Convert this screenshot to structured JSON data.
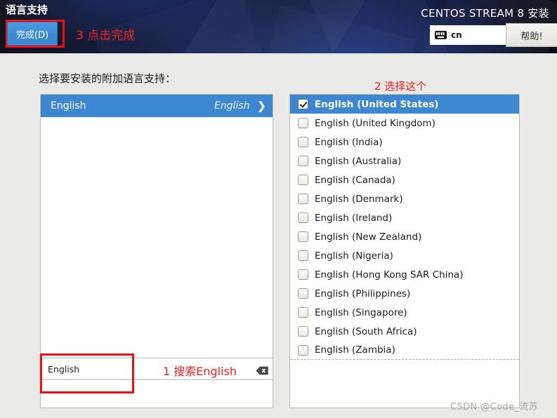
{
  "header": {
    "page_heading": "语言支持",
    "product_title": "CENTOS STREAM 8 安装",
    "done_label": "完成(D)",
    "keyboard_layout": "cn",
    "keyboard_icon": "keyboard-icon",
    "help_label": "帮助!"
  },
  "annotations": {
    "step1": "1 搜索English",
    "step2": "2 选择这个",
    "step3": "3 点击完成"
  },
  "main": {
    "prompt": "选择要安装的附加语言支持：",
    "language_list": [
      {
        "name": "English",
        "native": "English",
        "chevron": "❯",
        "selected": true
      }
    ],
    "locale_list": [
      {
        "label": "English (United States)",
        "checked": true,
        "selected": true
      },
      {
        "label": "English (United Kingdom)",
        "checked": false,
        "selected": false
      },
      {
        "label": "English (India)",
        "checked": false,
        "selected": false
      },
      {
        "label": "English (Australia)",
        "checked": false,
        "selected": false
      },
      {
        "label": "English (Canada)",
        "checked": false,
        "selected": false
      },
      {
        "label": "English (Denmark)",
        "checked": false,
        "selected": false
      },
      {
        "label": "English (Ireland)",
        "checked": false,
        "selected": false
      },
      {
        "label": "English (New Zealand)",
        "checked": false,
        "selected": false
      },
      {
        "label": "English (Nigeria)",
        "checked": false,
        "selected": false
      },
      {
        "label": "English (Hong Kong SAR China)",
        "checked": false,
        "selected": false
      },
      {
        "label": "English (Philippines)",
        "checked": false,
        "selected": false
      },
      {
        "label": "English (Singapore)",
        "checked": false,
        "selected": false
      },
      {
        "label": "English (South Africa)",
        "checked": false,
        "selected": false
      },
      {
        "label": "English (Zambia)",
        "checked": false,
        "selected": false,
        "cut": true
      }
    ]
  },
  "search": {
    "value": "English",
    "placeholder": "",
    "clear_icon": "backspace-clear-icon"
  },
  "watermark": "CSDN @Code_流苏",
  "colors": {
    "accent_blue": "#3c87d0",
    "annotation_red": "#f41f1f",
    "highlight_box_red": "#f20e10",
    "header_dark": "#0d1430",
    "page_bg": "#e9e9e7"
  }
}
